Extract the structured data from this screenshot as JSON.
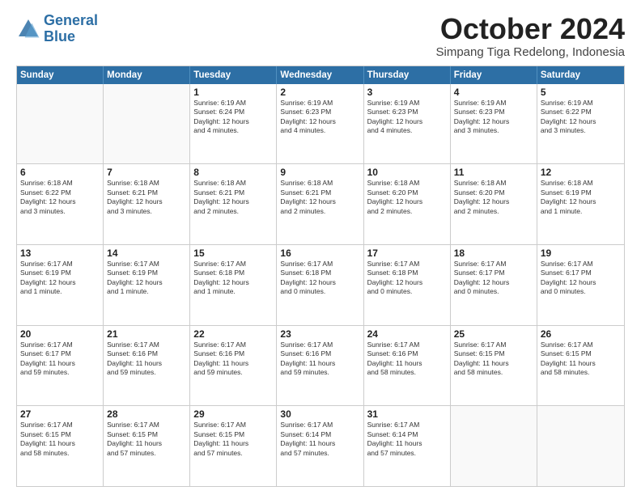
{
  "header": {
    "logo_general": "General",
    "logo_blue": "Blue",
    "month_title": "October 2024",
    "location": "Simpang Tiga Redelong, Indonesia"
  },
  "days_of_week": [
    "Sunday",
    "Monday",
    "Tuesday",
    "Wednesday",
    "Thursday",
    "Friday",
    "Saturday"
  ],
  "weeks": [
    [
      {
        "day": "",
        "info": "",
        "empty": true
      },
      {
        "day": "",
        "info": "",
        "empty": true
      },
      {
        "day": "1",
        "info": "Sunrise: 6:19 AM\nSunset: 6:24 PM\nDaylight: 12 hours\nand 4 minutes.",
        "empty": false
      },
      {
        "day": "2",
        "info": "Sunrise: 6:19 AM\nSunset: 6:23 PM\nDaylight: 12 hours\nand 4 minutes.",
        "empty": false
      },
      {
        "day": "3",
        "info": "Sunrise: 6:19 AM\nSunset: 6:23 PM\nDaylight: 12 hours\nand 4 minutes.",
        "empty": false
      },
      {
        "day": "4",
        "info": "Sunrise: 6:19 AM\nSunset: 6:23 PM\nDaylight: 12 hours\nand 3 minutes.",
        "empty": false
      },
      {
        "day": "5",
        "info": "Sunrise: 6:19 AM\nSunset: 6:22 PM\nDaylight: 12 hours\nand 3 minutes.",
        "empty": false
      }
    ],
    [
      {
        "day": "6",
        "info": "Sunrise: 6:18 AM\nSunset: 6:22 PM\nDaylight: 12 hours\nand 3 minutes.",
        "empty": false
      },
      {
        "day": "7",
        "info": "Sunrise: 6:18 AM\nSunset: 6:21 PM\nDaylight: 12 hours\nand 3 minutes.",
        "empty": false
      },
      {
        "day": "8",
        "info": "Sunrise: 6:18 AM\nSunset: 6:21 PM\nDaylight: 12 hours\nand 2 minutes.",
        "empty": false
      },
      {
        "day": "9",
        "info": "Sunrise: 6:18 AM\nSunset: 6:21 PM\nDaylight: 12 hours\nand 2 minutes.",
        "empty": false
      },
      {
        "day": "10",
        "info": "Sunrise: 6:18 AM\nSunset: 6:20 PM\nDaylight: 12 hours\nand 2 minutes.",
        "empty": false
      },
      {
        "day": "11",
        "info": "Sunrise: 6:18 AM\nSunset: 6:20 PM\nDaylight: 12 hours\nand 2 minutes.",
        "empty": false
      },
      {
        "day": "12",
        "info": "Sunrise: 6:18 AM\nSunset: 6:19 PM\nDaylight: 12 hours\nand 1 minute.",
        "empty": false
      }
    ],
    [
      {
        "day": "13",
        "info": "Sunrise: 6:17 AM\nSunset: 6:19 PM\nDaylight: 12 hours\nand 1 minute.",
        "empty": false
      },
      {
        "day": "14",
        "info": "Sunrise: 6:17 AM\nSunset: 6:19 PM\nDaylight: 12 hours\nand 1 minute.",
        "empty": false
      },
      {
        "day": "15",
        "info": "Sunrise: 6:17 AM\nSunset: 6:18 PM\nDaylight: 12 hours\nand 1 minute.",
        "empty": false
      },
      {
        "day": "16",
        "info": "Sunrise: 6:17 AM\nSunset: 6:18 PM\nDaylight: 12 hours\nand 0 minutes.",
        "empty": false
      },
      {
        "day": "17",
        "info": "Sunrise: 6:17 AM\nSunset: 6:18 PM\nDaylight: 12 hours\nand 0 minutes.",
        "empty": false
      },
      {
        "day": "18",
        "info": "Sunrise: 6:17 AM\nSunset: 6:17 PM\nDaylight: 12 hours\nand 0 minutes.",
        "empty": false
      },
      {
        "day": "19",
        "info": "Sunrise: 6:17 AM\nSunset: 6:17 PM\nDaylight: 12 hours\nand 0 minutes.",
        "empty": false
      }
    ],
    [
      {
        "day": "20",
        "info": "Sunrise: 6:17 AM\nSunset: 6:17 PM\nDaylight: 11 hours\nand 59 minutes.",
        "empty": false
      },
      {
        "day": "21",
        "info": "Sunrise: 6:17 AM\nSunset: 6:16 PM\nDaylight: 11 hours\nand 59 minutes.",
        "empty": false
      },
      {
        "day": "22",
        "info": "Sunrise: 6:17 AM\nSunset: 6:16 PM\nDaylight: 11 hours\nand 59 minutes.",
        "empty": false
      },
      {
        "day": "23",
        "info": "Sunrise: 6:17 AM\nSunset: 6:16 PM\nDaylight: 11 hours\nand 59 minutes.",
        "empty": false
      },
      {
        "day": "24",
        "info": "Sunrise: 6:17 AM\nSunset: 6:16 PM\nDaylight: 11 hours\nand 58 minutes.",
        "empty": false
      },
      {
        "day": "25",
        "info": "Sunrise: 6:17 AM\nSunset: 6:15 PM\nDaylight: 11 hours\nand 58 minutes.",
        "empty": false
      },
      {
        "day": "26",
        "info": "Sunrise: 6:17 AM\nSunset: 6:15 PM\nDaylight: 11 hours\nand 58 minutes.",
        "empty": false
      }
    ],
    [
      {
        "day": "27",
        "info": "Sunrise: 6:17 AM\nSunset: 6:15 PM\nDaylight: 11 hours\nand 58 minutes.",
        "empty": false
      },
      {
        "day": "28",
        "info": "Sunrise: 6:17 AM\nSunset: 6:15 PM\nDaylight: 11 hours\nand 57 minutes.",
        "empty": false
      },
      {
        "day": "29",
        "info": "Sunrise: 6:17 AM\nSunset: 6:15 PM\nDaylight: 11 hours\nand 57 minutes.",
        "empty": false
      },
      {
        "day": "30",
        "info": "Sunrise: 6:17 AM\nSunset: 6:14 PM\nDaylight: 11 hours\nand 57 minutes.",
        "empty": false
      },
      {
        "day": "31",
        "info": "Sunrise: 6:17 AM\nSunset: 6:14 PM\nDaylight: 11 hours\nand 57 minutes.",
        "empty": false
      },
      {
        "day": "",
        "info": "",
        "empty": true
      },
      {
        "day": "",
        "info": "",
        "empty": true
      }
    ]
  ]
}
